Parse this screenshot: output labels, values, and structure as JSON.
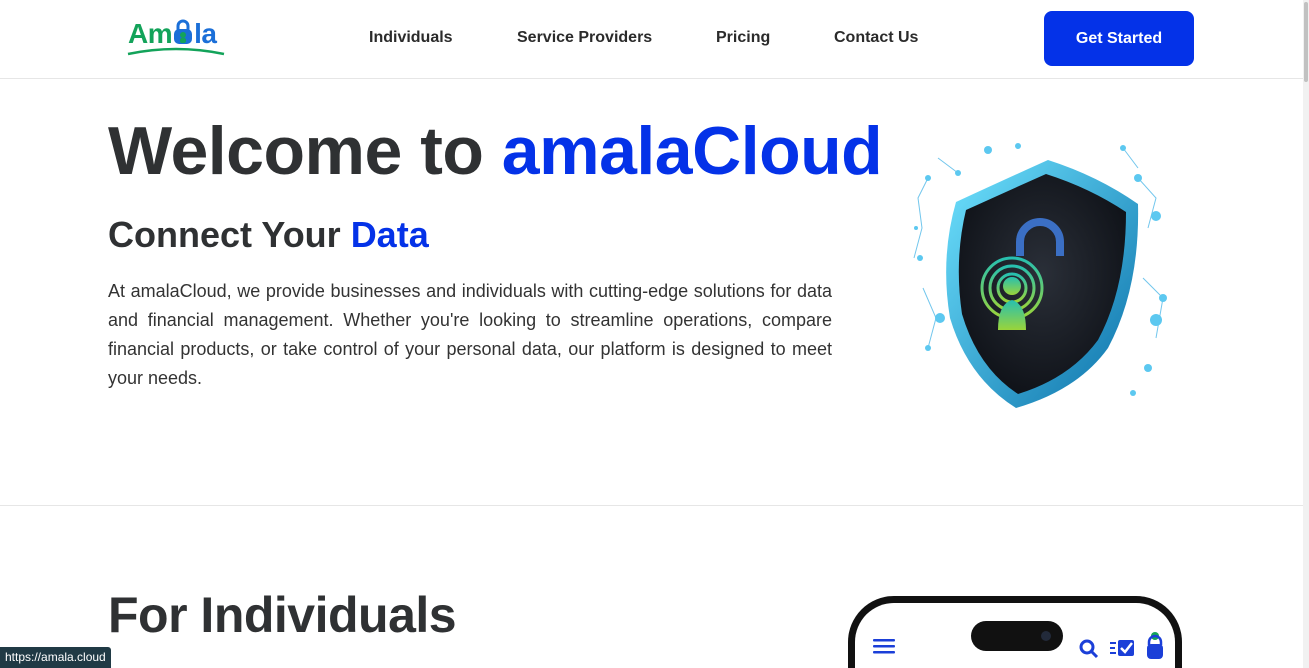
{
  "header": {
    "logo_text_1": "Am",
    "logo_text_2": "la",
    "nav": [
      {
        "label": "Individuals"
      },
      {
        "label": "Service Providers"
      },
      {
        "label": "Pricing"
      },
      {
        "label": "Contact Us"
      }
    ],
    "cta_label": "Get Started"
  },
  "hero": {
    "title_prefix": "Welcome to ",
    "title_accent": "amalaCloud",
    "subtitle_prefix": "Connect Your ",
    "subtitle_accent": "Data",
    "description": "At amalaCloud, we provide businesses and individuals with cutting-edge solutions for data and financial management. Whether you're looking to streamline operations, compare financial products, or take control of your personal data, our platform is designed to meet your needs."
  },
  "section": {
    "title": "For Individuals"
  },
  "status_bar": {
    "url": "https://amala.cloud"
  },
  "colors": {
    "accent": "#0432e8",
    "text_dark": "#2f3133",
    "logo_green": "#13a35a",
    "logo_blue": "#1b6fd8"
  },
  "icons": [
    "lock-icon",
    "shield-illustration",
    "menu-icon",
    "search-icon",
    "check-icon",
    "user-icon"
  ]
}
